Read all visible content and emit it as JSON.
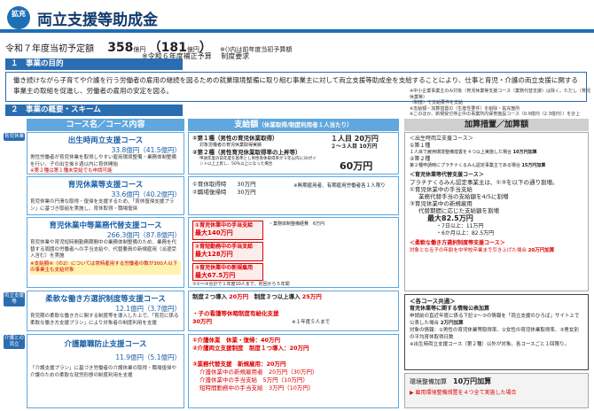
{
  "header": {
    "badge": "拡充",
    "title": "両立支援等助成金"
  },
  "budget": {
    "label": "令和７年度当初予定額",
    "amount": "358",
    "unit1": "億円",
    "paren_amount": "181",
    "unit2": "億円",
    "note": "※()内は前年度当初予算額",
    "sub": "※令和６年度補正予算　 制度要求"
  },
  "section1": {
    "title": "１　事業の目的",
    "text": "働き続けながら子育てや介護を行う労働者の雇用の継続を図るための就業環境整備に取り組む事業主に対して両立支援等助成金を支給することにより、仕事と育児・介護の両立支援に関する事業主の取組を促進し、労働者の雇用の安定を図る。"
  },
  "notes_tr": [
    "※中小企業事業主のみ対象（育児休業等支援コース（業務代替支援）は除く。ただし（育児休業等）",
    "（制度）で支給要件を支給",
    "※支給額・加算措置の（生産性要件）を削除・拡充箇所",
    "※このほか、新規受付停止中の事業所内保育施設コース（0.9億円（2.3億円））を計上"
  ],
  "section2": {
    "title": "２　事業の概要・スキーム"
  },
  "col1": {
    "head": "コース名／コース内容",
    "side_ikuji": "育児休業",
    "side_ryoritsu": "両立支援等",
    "side_kaigo": "介護との両立",
    "courses": [
      {
        "name": "出生時両立支援コース",
        "value": "33.8億円（41.5億円）",
        "desc": "男性労働者が育児休業を取得しやすい雇用環境整備・業務体制整備を行い、子の出生後８週以内に育休開始",
        "red": "※第２種は第１種未受給でも申請可能"
      },
      {
        "name": "育児休業等支援コース",
        "value": "33.6億円（40.2億円）",
        "desc": "育児休業の円滑な取得・復帰を支援するため、「育休復帰支援プラン」に基づき取組を実施し、育休取得・職場復帰"
      },
      {
        "name": "育児休業中等業務代替支援コース",
        "value": "266.3億円（87.8億円）",
        "desc": "育児休業や育児短時間勤務期間中の業務体制整備のため、業務を代替する周囲の労働者への手当支給や、代替要員の新規雇用（派遣受入含む）を実施",
        "red": "※支給額④（の2）については常時雇用する労働者の数が300人以下の事業主も支給対象"
      },
      {
        "name": "柔軟な働き方選択制度等支援コース",
        "value": "12.1億円（3.7億円）",
        "desc": "育児期の柔軟な働き方に関する制度等を導入した上で、「育児に係る柔軟な働き方支援プラン」により対象者の制度利用を支援"
      },
      {
        "name": "介護離職防止支援コース",
        "value": "11.9億円（5.1億円）",
        "desc": "「介護支援プラン」に基づき労働者の介護休業の取得・職場復帰や介護のための柔軟な就労形態の制度利用を支援"
      }
    ]
  },
  "col2": {
    "head": "支給額",
    "head_note": "（休業取得/制度利用者１人当たり）",
    "a1": "①第１種（男性の育児休業取得）",
    "a1_val": "１人目 20万円",
    "a1_val2": "２～３人目 10万円",
    "a1_note": "対象労働者の育児休業取得実績",
    "a2": "②第２種（男性育児休業取得率の上昇等）",
    "a2_note": "申請年度の前年度を基準とし男性育休取得率が３年以内に30ポイント以上上昇し、50％以上になった場合",
    "a2_val": "60万円",
    "b1": "①育休取得時",
    "b1_val": "30万円",
    "b2": "②職場復帰時",
    "b2_val": "30万円",
    "b_note": "※無期雇用者、有期雇用労働者各１人限り",
    "c1_title": "①育児休業中の手当支給",
    "c1_val": "最大140万円",
    "c1_sub": "・業務体制整備経費　6万円",
    "c2_title": "②育短勤務中の手当支給",
    "c2_val": "最大128万円",
    "c3_title": "③育児休業中の新規雇用",
    "c3_val": "最大67.5万円",
    "c_note": "①①～③合計で１年度10人まで、初回から５年間",
    "d1": "制度２つ導入",
    "d1_val": "20万円",
    "d2": "制度３つ以上導入",
    "d2_val": "25万円",
    "d3": "・子の看護等休暇制度有給化支援",
    "d3_val": "30万円",
    "d3_note": "※１年度５人まで",
    "e1": "①介護休業",
    "e1_desc": "休業・復帰：40万円",
    "e2": "②介護両立支援制度",
    "e2_desc": "制度１つ導入：20万円",
    "e3": "③業務代替支援",
    "e3_desc": "新規雇用：20万円",
    "e4": "介護休業中の新規雇用者",
    "e4_val": "20万円（30万円）",
    "e5": "介護休業中の手当支給",
    "e5_val": "5万円（10万円）",
    "e6": "短時間勤務中の手当支給",
    "e6_val": "3万円（10万円）"
  },
  "col3": {
    "head": "加算措置／加算額",
    "lead": "＜出生時両立支援コース＞",
    "p1": "①第１種",
    "p1_a": "１人目で雇用環境整備措置を４つ以上実施した場合",
    "p1_a_val": "10万円加算",
    "p2": "②第２種",
    "p2_a": "第２種申請時にプラチナくるみん認定事業主である場合",
    "p2_a_val": "15万円加算",
    "p3": "＜育児休業等代替支援コース＞",
    "p3_a": "プラチナくるみん認定事業主は、①③を以下の通り割増。",
    "p3_b": "①育児休業中の手当支給",
    "p3_c": "業務代替手当の支給額を4/5に割増",
    "p3_d": "③育児休業中の新規雇用",
    "p3_e": "代替期間に応じた支給額を割増",
    "p3_f": "最大82.5万円",
    "p3_g": "・7日以上：11万円",
    "p3_h": "・6か月以上：82.5万円",
    "p3_i": "＜柔軟な働き方選択制度等支援コース＞",
    "p3_j": "対象となる子の年齢を中学校卒業まで引き上げた場合",
    "p3_j_val": "20万円加算",
    "q_title": "＜各コース共通＞",
    "q1": "育児休業等に関する情報公表加算",
    "q2": "申請前の直近年度に係る下記①～③の情報を「両立支援のひろば」サイト上で公表した場合",
    "q2_val": "2万円加算",
    "q3": "対象の情報：①男性の育児休業等取得率、②女性の育児休業取得率、③男女別の平均育休取得日数",
    "q4": "※出生時両立支援コース（第２種）以外が対象。各コースごと１回限り。",
    "r1": "環境整備加算",
    "r1_val": "10万円加算",
    "r2": "▶ 雇用環境整備措置を４つ全て実施した場合"
  }
}
